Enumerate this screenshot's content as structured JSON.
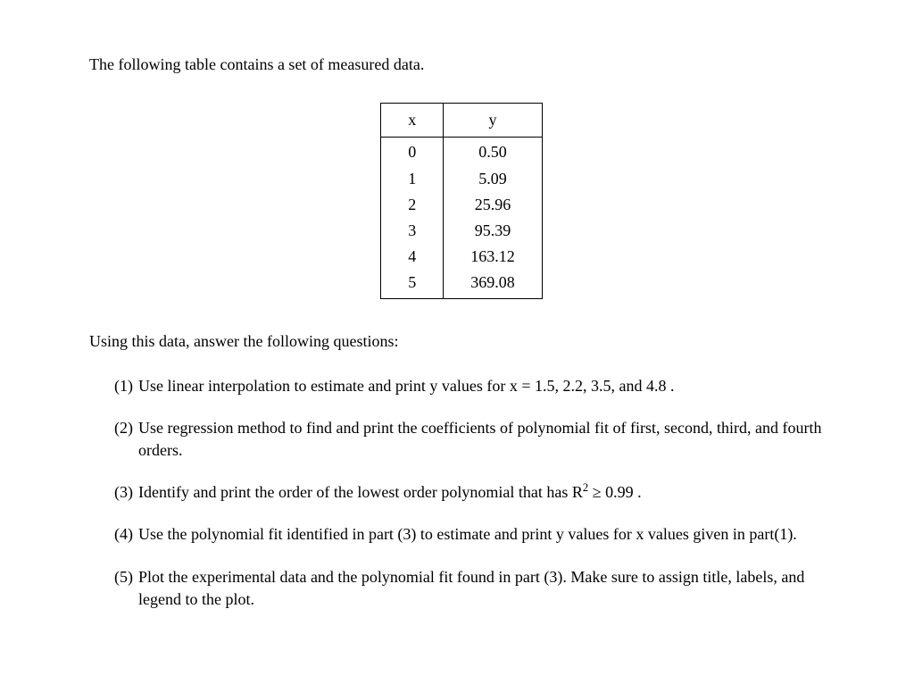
{
  "intro": "The following table contains a set of measured data.",
  "table": {
    "headers": {
      "x": "x",
      "y": "y"
    },
    "rows": [
      {
        "x": "0",
        "y": "0.50"
      },
      {
        "x": "1",
        "y": "5.09"
      },
      {
        "x": "2",
        "y": "25.96"
      },
      {
        "x": "3",
        "y": "95.39"
      },
      {
        "x": "4",
        "y": "163.12"
      },
      {
        "x": "5",
        "y": "369.08"
      }
    ]
  },
  "lead": "Using this data, answer the following questions:",
  "questions": [
    {
      "num": "(1)",
      "text": "Use linear interpolation to estimate and print y values for x = 1.5, 2.2, 3.5, and 4.8 ."
    },
    {
      "num": "(2)",
      "text": "Use regression method to find and print the coefficients of polynomial fit of first, second, third, and fourth orders."
    },
    {
      "num": "(3)",
      "text_pre": "Identify and print the order of the lowest order polynomial that has ",
      "rsq_base": "R",
      "rsq_sup": "2",
      "text_post": " ≥ 0.99 ."
    },
    {
      "num": "(4)",
      "text": "Use the polynomial fit identified in part (3) to estimate and print y values for x values given in part(1)."
    },
    {
      "num": "(5)",
      "text": "Plot the experimental data and the polynomial fit found in part (3). Make sure to assign title, labels, and legend to the plot."
    }
  ]
}
